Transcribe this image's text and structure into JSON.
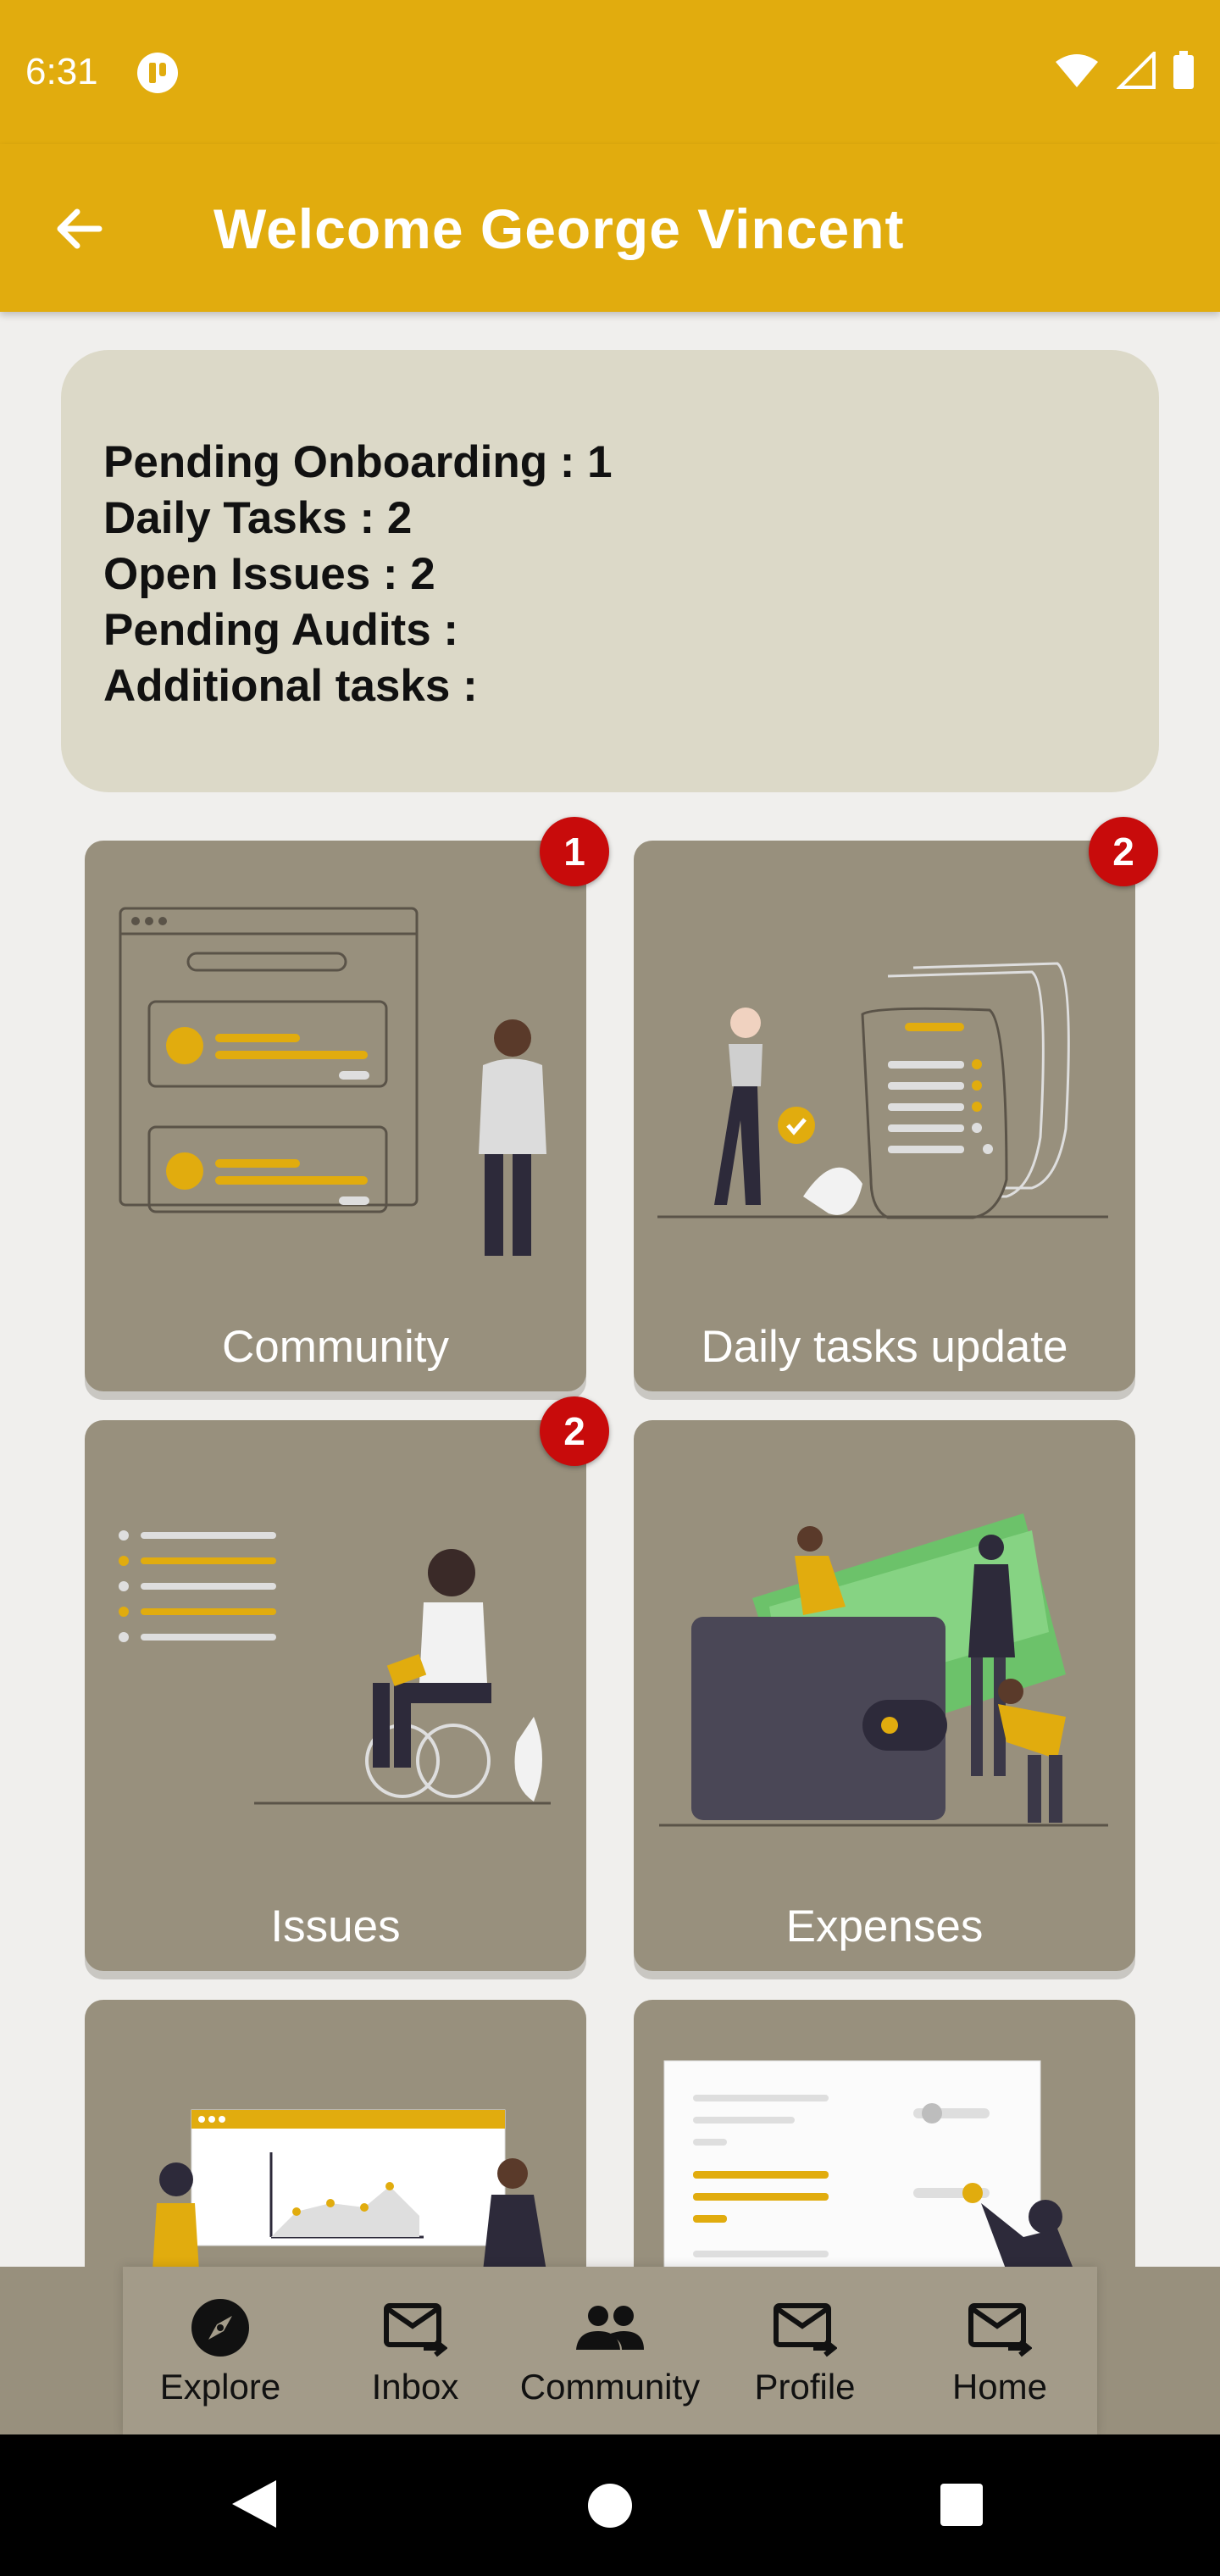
{
  "status": {
    "time": "6:31",
    "icons": [
      "app-notification-icon",
      "wifi-icon",
      "cell-signal-icon",
      "battery-icon"
    ]
  },
  "appbar": {
    "title": "Welcome George Vincent",
    "back_icon": "arrow-left-icon"
  },
  "summary": {
    "lines": [
      "Pending Onboarding : 1",
      "Daily Tasks : 2",
      "Open Issues : 2",
      "Pending Audits :",
      "Additional tasks :"
    ]
  },
  "tiles": [
    {
      "label": "Community",
      "badge": "1"
    },
    {
      "label": "Daily tasks update",
      "badge": "2"
    },
    {
      "label": "Issues",
      "badge": "2"
    },
    {
      "label": "Expenses",
      "badge": ""
    },
    {
      "label": "",
      "badge": ""
    },
    {
      "label": "",
      "badge": ""
    }
  ],
  "nav": {
    "items": [
      {
        "label": "Explore",
        "icon": "compass-icon"
      },
      {
        "label": "Inbox",
        "icon": "mail-forward-icon"
      },
      {
        "label": "Community",
        "icon": "people-icon"
      },
      {
        "label": "Profile",
        "icon": "mail-forward-icon"
      },
      {
        "label": "Home",
        "icon": "mail-forward-icon"
      }
    ]
  },
  "colors": {
    "accent": "#e1ac0e",
    "tile": "#98907d",
    "badge": "#c80b0b",
    "summary_bg": "#dcd9c8"
  }
}
